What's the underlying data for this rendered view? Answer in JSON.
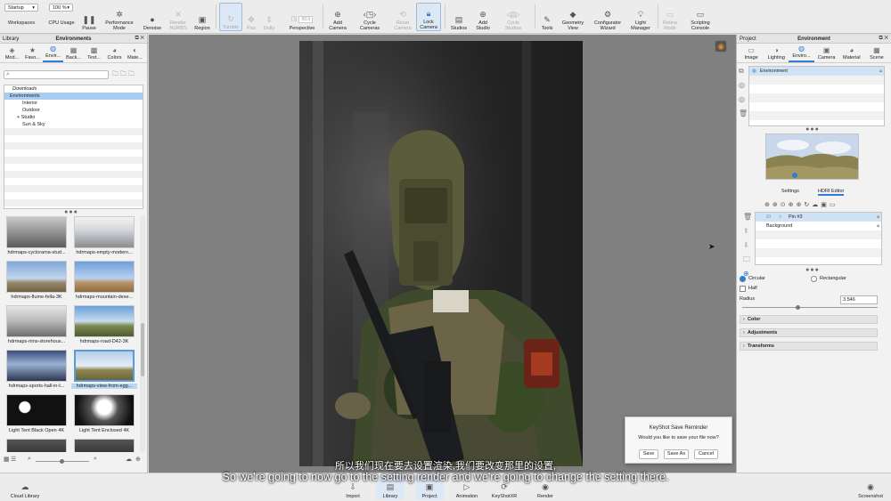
{
  "toolbar": {
    "workspace_select": "Startup",
    "zoom_select": "100 %",
    "workspaces": "Workspaces",
    "cpu_usage": "CPU Usage",
    "pause": "Pause",
    "performance_mode": "Performance\nMode",
    "denoise": "Denoise",
    "render_nurbs": "Render\nNURBS",
    "region": "Region",
    "tumble": "Tumble",
    "pan": "Pan",
    "dolly": "Dolly",
    "fov_value": "50.0",
    "perspective": "Perspective",
    "add_camera": "Add\nCamera",
    "cycle_cameras": "Cycle\nCameras",
    "reset_camera": "Reset\nCamera",
    "lock_camera": "Lock\nCamera",
    "studios": "Studios",
    "add_studio": "Add\nStudio",
    "cycle_studios": "Cycle\nStudios",
    "tools": "Tools",
    "geometry_view": "Geometry\nView",
    "configurator_wizard": "Configurator\nWizard",
    "light_manager": "Light\nManager",
    "retina_mode": "Retina\nMode",
    "scripting_console": "Scripting\nConsole"
  },
  "library": {
    "panel_label": "Library",
    "title": "Environments",
    "tabs": [
      "Mod...",
      "Favo...",
      "Envir...",
      "Back...",
      "Text...",
      "Colors",
      "Mate..."
    ],
    "active_tab": 2,
    "tree": [
      {
        "label": "Downloads",
        "indent": 0,
        "italic": true
      },
      {
        "label": "Environments",
        "indent": 0,
        "selected": true
      },
      {
        "label": "Interior",
        "indent": 1
      },
      {
        "label": "Outdoor",
        "indent": 1
      },
      {
        "label": "Studio",
        "indent": 1,
        "expand": true
      },
      {
        "label": "Sun & Sky",
        "indent": 1
      }
    ],
    "thumbnails": [
      {
        "label": "hdrmaps-cyclorama-stud...",
        "style": "cyc"
      },
      {
        "label": "hdrmaps-empty-modern...",
        "style": "hall"
      },
      {
        "label": "hdrmaps-flume-fella-3K",
        "style": "sky"
      },
      {
        "label": "hdrmaps-mountain-dese...",
        "style": "desert"
      },
      {
        "label": "hdrmaps-rims-storehous...",
        "style": "store"
      },
      {
        "label": "hdrmaps-road-D42-3K",
        "style": "road"
      },
      {
        "label": "hdrmaps-sports-hall-in-t...",
        "style": "sports"
      },
      {
        "label": "hdrmaps-view-from-egg...",
        "style": "egg",
        "selected": true
      },
      {
        "label": "Light Tent Black Open 4K",
        "style": "tentblack"
      },
      {
        "label": "Light Tent Enclosed 4K",
        "style": "tentwhite"
      },
      {
        "label": "",
        "style": "dark"
      },
      {
        "label": "",
        "style": "dark"
      }
    ]
  },
  "project": {
    "panel_label": "Project",
    "title": "Environment",
    "tabs": [
      "Image",
      "Lighting",
      "Enviro...",
      "Camera",
      "Material",
      "Scene"
    ],
    "active_tab": 2,
    "env_list": [
      "Environment"
    ],
    "subtabs": [
      "Settings",
      "HDRI Editor"
    ],
    "active_subtab": 1,
    "pins": [
      "Pin #3",
      "Background"
    ],
    "shape_circular": "Circular",
    "shape_rectangular": "Rectangular",
    "half": "Half",
    "radius_label": "Radius",
    "radius_value": "3.546",
    "radius_slider": 0.4,
    "sections": [
      "Color",
      "Adjustments",
      "Transforms"
    ]
  },
  "dialog": {
    "title": "KeyShot Save Reminder",
    "message": "Would you like to save your file now?",
    "save": "Save",
    "save_as": "Save As",
    "cancel": "Cancel"
  },
  "subtitles": {
    "chinese": "所以我们现在要去设置渲染,我们要改变那里的设置,",
    "english": "So we're going to now go to the setting render and we're going to change the setting there."
  },
  "bottombar": {
    "cloud_library": "Cloud Library",
    "tabs": [
      "Import",
      "Library",
      "Project",
      "Animation",
      "KeyShotXR",
      "Render"
    ],
    "active_tabs": [
      "Library",
      "Project"
    ],
    "screenshot": "Screenshot"
  },
  "colors": {
    "accent": "#2f7dd6",
    "selection": "#a8cdef",
    "viewport_bg": "#808080"
  }
}
